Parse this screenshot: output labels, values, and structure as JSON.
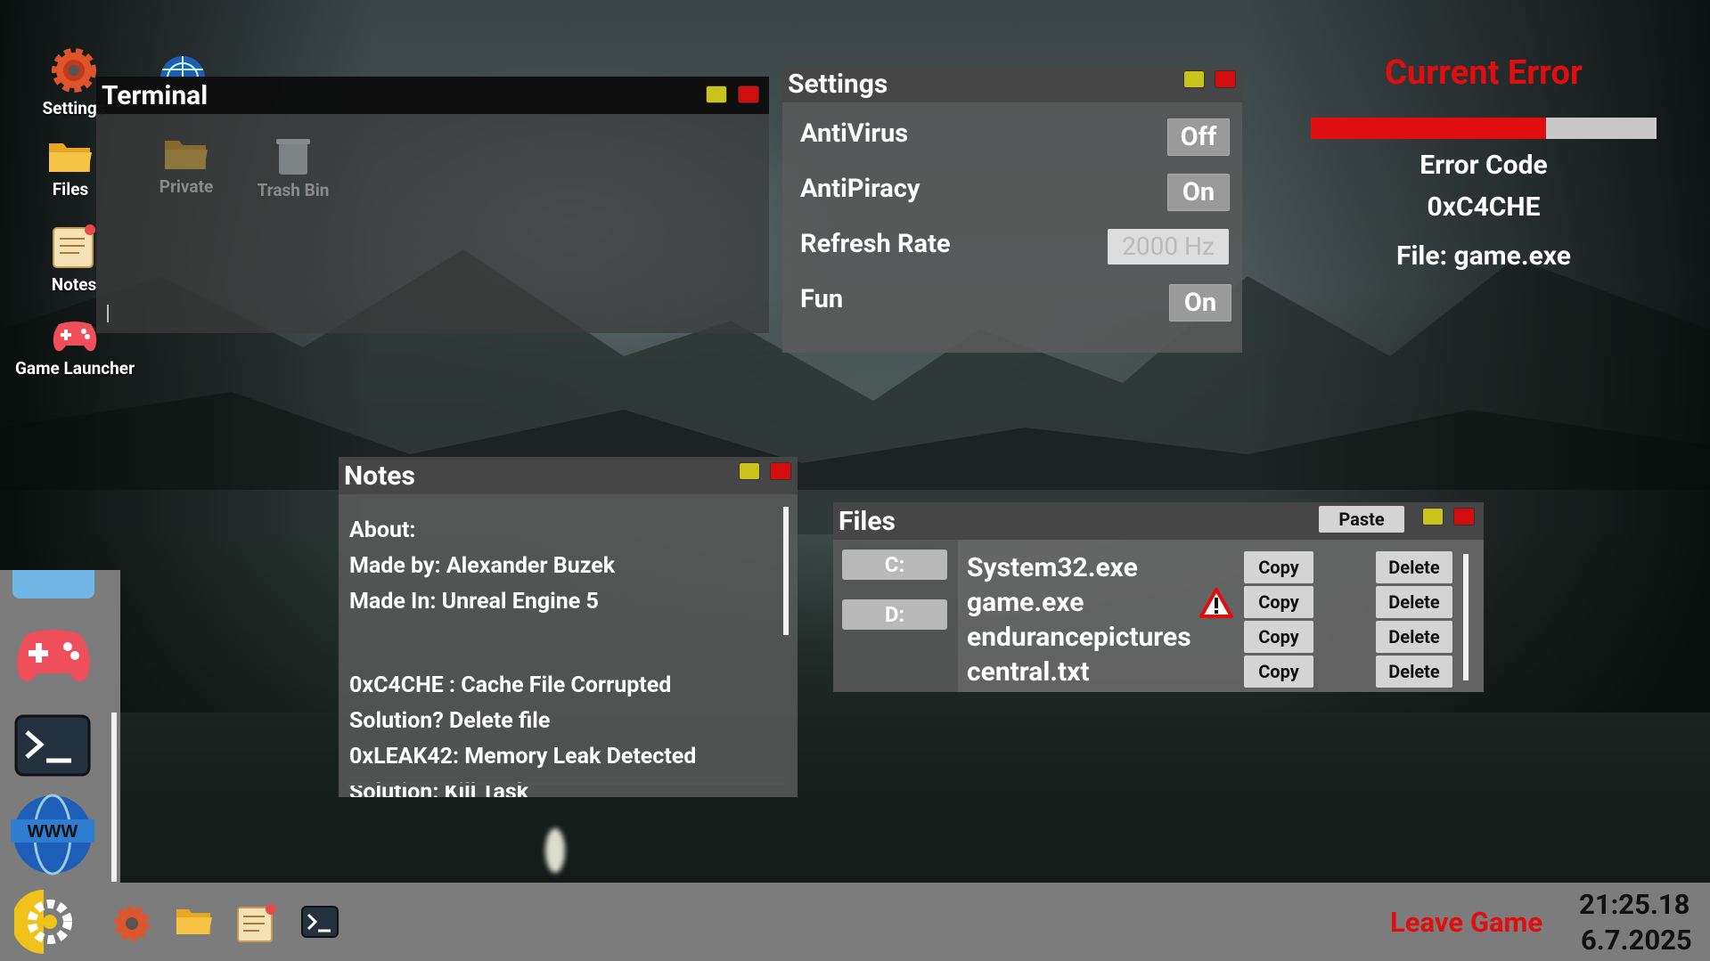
{
  "desktop": {
    "icons": [
      {
        "label": "Settings"
      },
      {
        "label": "Files"
      },
      {
        "label": "Notes"
      },
      {
        "label": "Game Launcher"
      },
      {
        "label": "Private"
      },
      {
        "label": "Trash Bin"
      }
    ]
  },
  "terminal": {
    "title": "Terminal"
  },
  "settings": {
    "title": "Settings",
    "rows": [
      {
        "label": "AntiVirus",
        "value": "Off"
      },
      {
        "label": "AntiPiracy",
        "value": "On"
      },
      {
        "label": "Refresh Rate",
        "value": "2000 Hz"
      },
      {
        "label": "Fun",
        "value": "On"
      }
    ]
  },
  "error_panel": {
    "title": "Current Error",
    "progress": 0.68,
    "code_label": "Error Code",
    "code": "0xC4CHE",
    "file": "File: game.exe",
    "accent": "#e00e0e"
  },
  "notes": {
    "title": "Notes",
    "lines": [
      "About:",
      "Made by: Alexander Buzek",
      "Made In: Unreal Engine 5",
      "",
      "0xC4CHE : Cache File Corrupted",
      "Solution? Delete file",
      "0xLEAK42: Memory Leak Detected",
      "Solution: Kill Task"
    ]
  },
  "files": {
    "title": "Files",
    "paste_label": "Paste",
    "drives": [
      "C:",
      "D:"
    ],
    "items": [
      {
        "name": "System32.exe",
        "copy": "Copy",
        "delete": "Delete",
        "warning": false
      },
      {
        "name": "game.exe",
        "copy": "Copy",
        "delete": "Delete",
        "warning": true
      },
      {
        "name": "endurancepictures",
        "copy": "Copy",
        "delete": "Delete",
        "warning": false
      },
      {
        "name": "central.txt",
        "copy": "Copy",
        "delete": "Delete",
        "warning": false
      }
    ]
  },
  "taskbar": {
    "leave_label": "Leave Game",
    "time": "21:25.18",
    "date": "6.7.2025"
  }
}
